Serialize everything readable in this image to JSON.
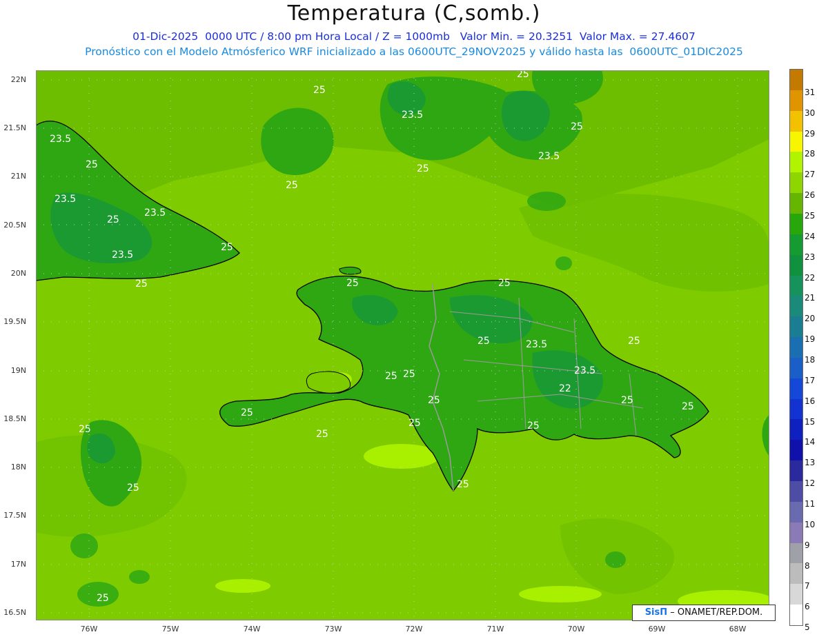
{
  "title": "Temperatura (C,somb.)",
  "subtitle1": "01-Dic-2025  0000 UTC / 8:00 pm Hora Local / Z = 1000mb   Valor Min. = 20.3251  Valor Max. = 27.4607",
  "subtitle2": "Pronóstico con el Modelo Atmósferico WRF inicializado a las 0600UTC_29NOV2025 y válido hasta las  0600UTC_01DIC2025",
  "y_axis_labels": [
    "22N",
    "21.5N",
    "21N",
    "20.5N",
    "20N",
    "19.5N",
    "19N",
    "18.5N",
    "18N",
    "17.5N",
    "17N",
    "16.5N"
  ],
  "x_axis_labels": [
    "76W",
    "75W",
    "74W",
    "73W",
    "72W",
    "71W",
    "70W",
    "69W",
    "68W"
  ],
  "contour_labels": [
    "25",
    "23.5",
    "22"
  ],
  "colorbar": {
    "labels": [
      "31",
      "30",
      "29",
      "28",
      "27",
      "26",
      "25",
      "24",
      "23",
      "22",
      "21",
      "20",
      "19",
      "18",
      "17",
      "16",
      "15",
      "14",
      "13",
      "12",
      "11",
      "10",
      "9",
      "8",
      "7",
      "6",
      "5"
    ],
    "colors": [
      "#c47a00",
      "#e09400",
      "#f2c100",
      "#f7f600",
      "#b2f400",
      "#8fd600",
      "#66b500",
      "#27a70a",
      "#149c30",
      "#10913e",
      "#16935c",
      "#1a8a7a",
      "#1a7d92",
      "#1a6fb2",
      "#1a5ec8",
      "#1547d8",
      "#1232d2",
      "#0f20c0",
      "#1010aa",
      "#2a2a9e",
      "#4d4da6",
      "#6a6ab0",
      "#8a7ab6",
      "#a0a0a8",
      "#bcbcbc",
      "#d8d8d8",
      "#ffffff"
    ]
  },
  "credit": {
    "brand": "SisΠ",
    "rest": "– ONAMET/REP.DOM."
  },
  "colors": {
    "ocean": "#7ecc00",
    "warm_sea": "#a8f000",
    "land": "#2ea713",
    "land_cool": "#1c9a32",
    "coast": "#000000",
    "borders": "#9a9a9a"
  }
}
